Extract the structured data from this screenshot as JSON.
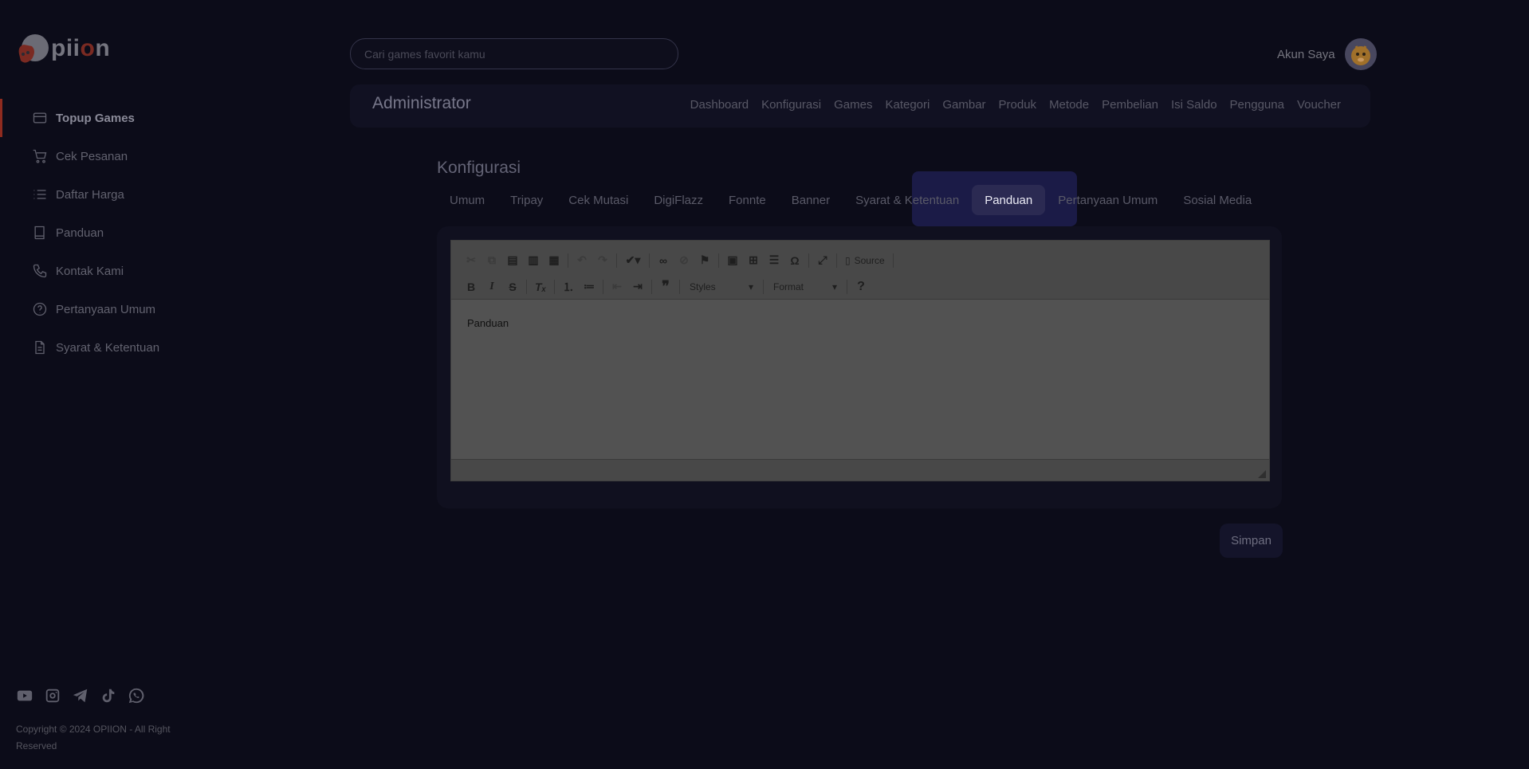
{
  "brand": {
    "logo_text_a": "pii",
    "logo_text_b": "o",
    "logo_text_c": "n",
    "accent": "#8f2b1f"
  },
  "sidebar": {
    "items": [
      {
        "label": "Topup Games",
        "icon": "card-icon",
        "active": true
      },
      {
        "label": "Cek Pesanan",
        "icon": "cart-icon"
      },
      {
        "label": "Daftar Harga",
        "icon": "list-icon"
      },
      {
        "label": "Panduan",
        "icon": "book-icon"
      },
      {
        "label": "Kontak Kami",
        "icon": "phone-icon"
      },
      {
        "label": "Pertanyaan Umum",
        "icon": "help-circle-icon"
      },
      {
        "label": "Syarat & Ketentuan",
        "icon": "document-icon"
      }
    ],
    "social": [
      "youtube-icon",
      "instagram-icon",
      "telegram-icon",
      "tiktok-icon",
      "whatsapp-icon"
    ],
    "copyright": "Copyright © 2024 OPIION - All Right Reserved"
  },
  "header": {
    "search_placeholder": "Cari games favorit kamu",
    "account_label": "Akun Saya"
  },
  "admin": {
    "title": "Administrator",
    "menu": [
      "Dashboard",
      "Konfigurasi",
      "Games",
      "Kategori",
      "Gambar",
      "Produk",
      "Metode",
      "Pembelian",
      "Isi Saldo",
      "Pengguna",
      "Voucher"
    ]
  },
  "config": {
    "title": "Konfigurasi",
    "tabs": [
      "Umum",
      "Tripay",
      "Cek Mutasi",
      "DigiFlazz",
      "Fonnte",
      "Banner",
      "Syarat & Ketentuan",
      "Panduan",
      "Pertanyaan Umum",
      "Sosial Media"
    ],
    "active_tab": "Panduan",
    "editor": {
      "source_label": "Source",
      "styles_label": "Styles",
      "format_label": "Format",
      "help_label": "?",
      "content": "Panduan"
    },
    "save_label": "Simpan"
  }
}
